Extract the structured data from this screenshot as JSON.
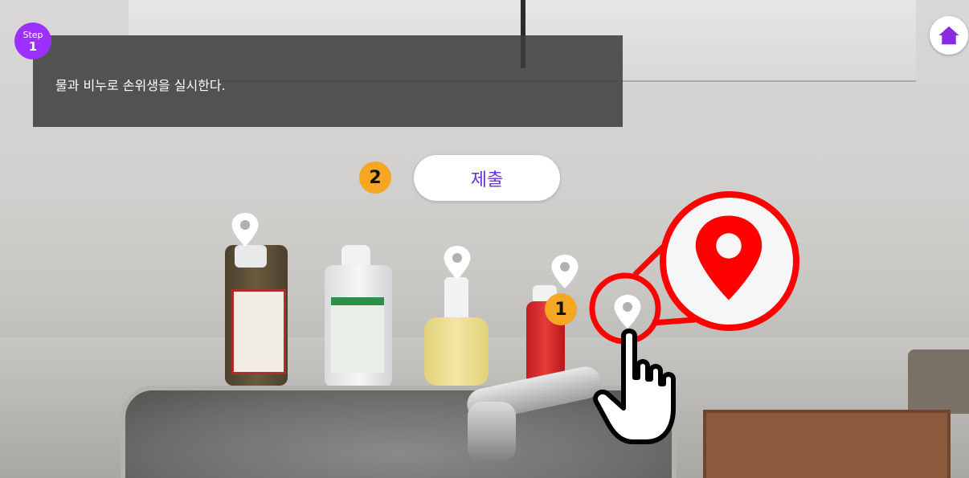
{
  "step": {
    "label": "Step",
    "number": "1"
  },
  "instruction": "물과 비누로 손위생을 실시한다.",
  "submit_label": "제출",
  "badges": {
    "one": "1",
    "two": "2"
  },
  "colors": {
    "accent": "#9b30ff",
    "submit_text": "#6b2fd6",
    "badge": "#f5a623",
    "highlight": "#ff0000"
  },
  "icons": {
    "home": "home-icon",
    "pin": "location-pin-icon",
    "hand": "pointing-hand-icon"
  }
}
